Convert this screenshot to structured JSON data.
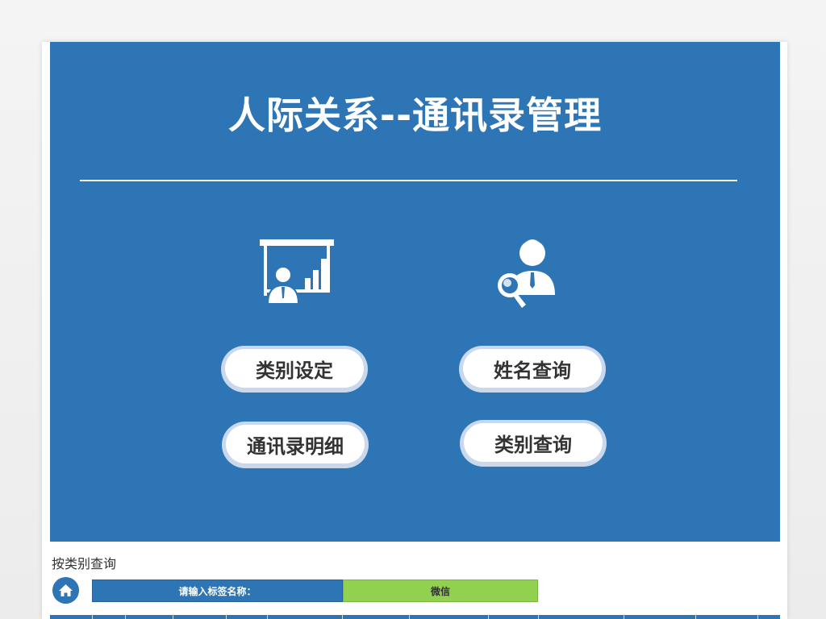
{
  "title": "人际关系--通讯录管理",
  "buttons": {
    "category_setting": "类别设定",
    "name_query": "姓名查询",
    "contacts_detail": "通讯录明细",
    "category_query": "类别查询"
  },
  "section": {
    "title": "按类别查询",
    "label": "请输入标签名称：",
    "value": "微信"
  },
  "colors": {
    "panel": "#2e75b6",
    "accent_green": "#92d050",
    "button_text": "#333333"
  },
  "icons": [
    "presentation-chart-icon",
    "person-search-icon",
    "home-icon"
  ]
}
